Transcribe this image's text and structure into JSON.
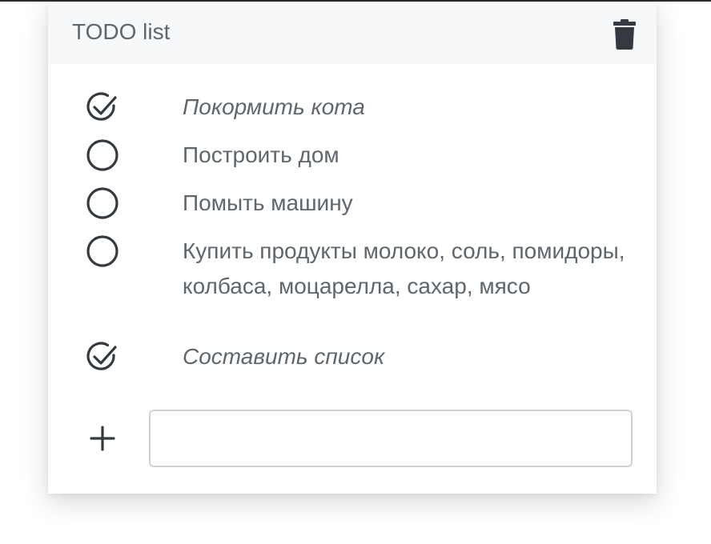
{
  "header": {
    "title": "TODO list",
    "clear_icon": "trash-icon"
  },
  "todos": [
    {
      "text": "Покормить кота",
      "done": true
    },
    {
      "text": "Построить дом",
      "done": false
    },
    {
      "text": "Помыть машину",
      "done": false
    },
    {
      "text": "Купить продукты молоко, соль, помидоры, колбаса, моцарелла, сахар, мясо",
      "done": false
    },
    {
      "text": "Составить список",
      "done": true
    }
  ],
  "add_form": {
    "add_icon": "plus-icon",
    "input_value": "",
    "input_placeholder": ""
  },
  "colors": {
    "text": "#5f666d",
    "icon": "#343a40",
    "header_bg": "#f7f8fa",
    "input_border": "#cfd3d7"
  }
}
